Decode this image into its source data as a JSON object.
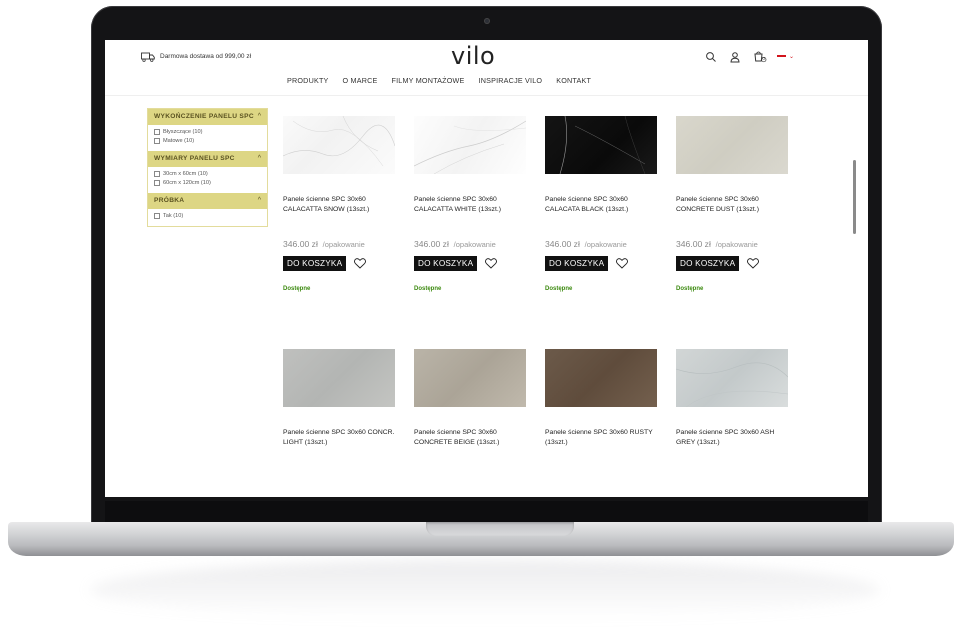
{
  "header": {
    "shipping_text": "Darmowa dostawa od 999,00 zł",
    "logo": "vilo",
    "nav": [
      "PRODUKTY",
      "O MARCE",
      "FILMY MONTAŻOWE",
      "INSPIRACJE VILO",
      "KONTAKT"
    ],
    "icons": [
      "search-icon",
      "user-icon",
      "cart-icon",
      "flag-pl-icon"
    ],
    "cart_count": "0"
  },
  "sidebar": {
    "filters": [
      {
        "title": "WYKOŃCZENIE PANELU SPC",
        "options": [
          "Błyszczące (10)",
          "Matowe (10)"
        ]
      },
      {
        "title": "WYMIARY PANELU SPC",
        "options": [
          "30cm x 60cm (10)",
          "60cm x 120cm (10)"
        ]
      },
      {
        "title": "PRÓBKA",
        "options": [
          "Tak (10)"
        ]
      }
    ]
  },
  "products": [
    {
      "name": "Panele ścienne SPC 30x60 CALACATTA SNOW (13szt.)",
      "price": "346.00 zł",
      "unit": "/opakowanie",
      "cart_label": "DO KOSZYKA",
      "availability": "Dostępne"
    },
    {
      "name": "Panele ścienne SPC 30x60 CALACATTA WHITE (13szt.)",
      "price": "346.00 zł",
      "unit": "/opakowanie",
      "cart_label": "DO KOSZYKA",
      "availability": "Dostępne"
    },
    {
      "name": "Panele ścienne SPC 30x60 CALACATA BLACK (13szt.)",
      "price": "346.00 zł",
      "unit": "/opakowanie",
      "cart_label": "DO KOSZYKA",
      "availability": "Dostępne"
    },
    {
      "name": "Panele ścienne SPC 30x60 CONCRETE DUST (13szt.)",
      "price": "346.00 zł",
      "unit": "/opakowanie",
      "cart_label": "DO KOSZYKA",
      "availability": "Dostępne"
    },
    {
      "name": "Panele ścienne SPC 30x60 CONCR. LIGHT (13szt.)"
    },
    {
      "name": "Panele ścienne SPC 30x60 CONCRETE BEIGE (13szt.)"
    },
    {
      "name": "Panele ścienne SPC 30x60 RUSTY (13szt.)"
    },
    {
      "name": "Panele ścienne SPC 30x60 ASH GREY (13szt.)"
    }
  ],
  "colors": {
    "filter_header": "#ddd684",
    "available": "#3c8a10",
    "button": "#111111"
  }
}
